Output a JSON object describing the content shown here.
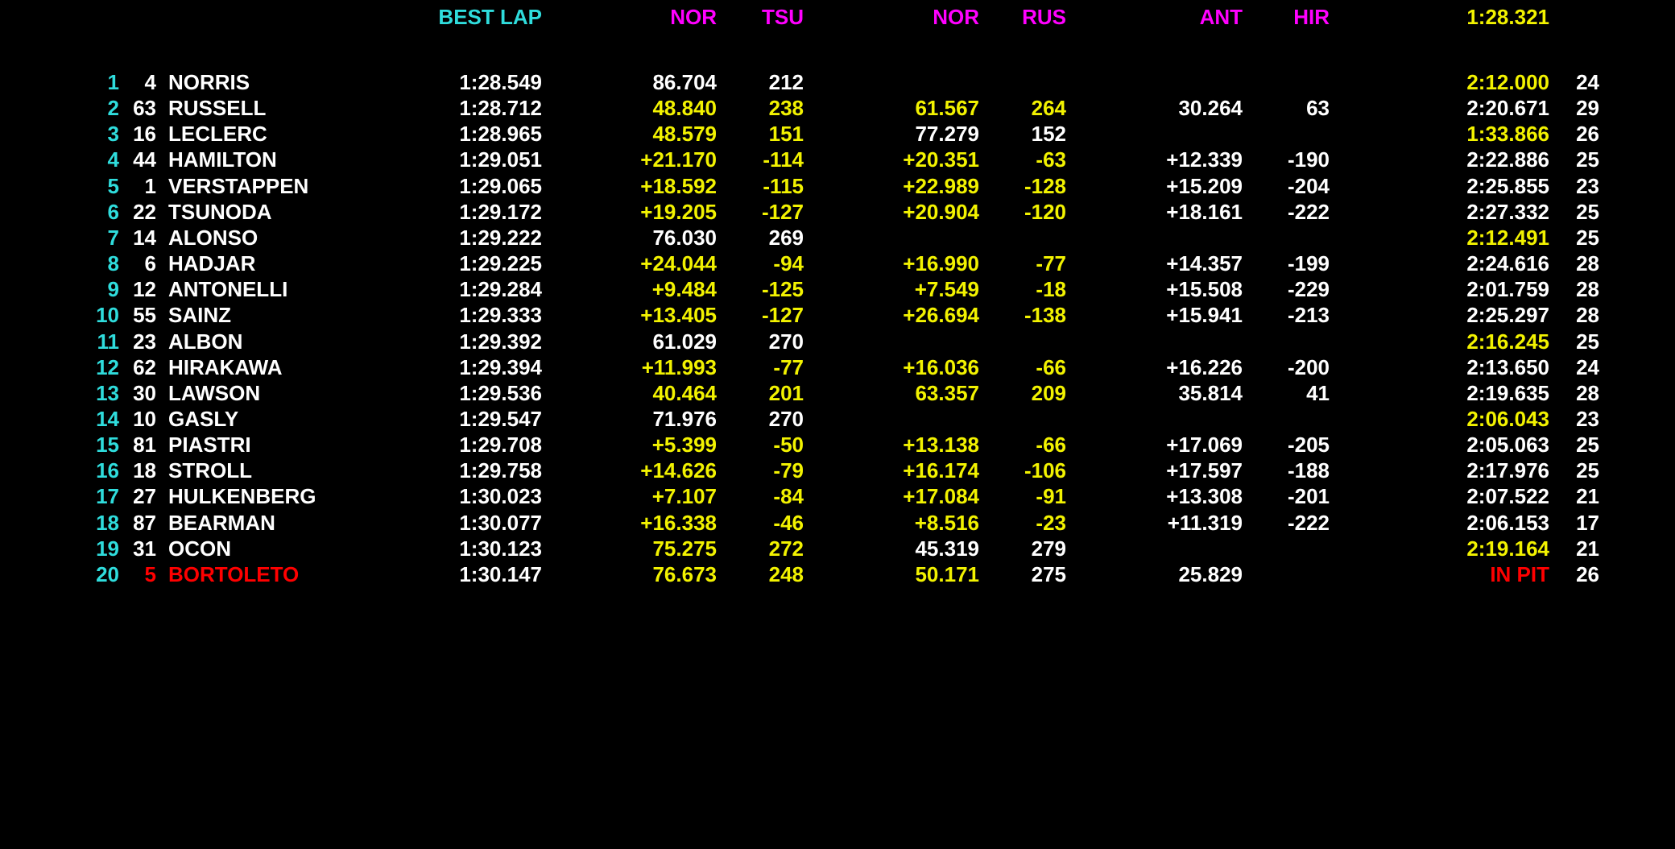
{
  "colors": {
    "background": "#000000",
    "white": "#ffffff",
    "yellow": "#f2f200",
    "cyan": "#2fdcdc",
    "magenta": "#ff00ff",
    "red": "#ff0000"
  },
  "header": {
    "best_lap": "BEST LAP",
    "g1": "NOR",
    "s1": "TSU",
    "g2": "NOR",
    "s2": "RUS",
    "g3": "ANT",
    "s3": "HIR",
    "last": "1:28.321"
  },
  "rows": [
    {
      "pos": "1",
      "num": "4",
      "name": "NORRIS",
      "best": "1:28.549",
      "g1": "86.704",
      "g1c": "white",
      "s1": "212",
      "s1c": "white",
      "g2": "",
      "g2c": "white",
      "s2": "",
      "s2c": "white",
      "g3": "",
      "s3": "",
      "last": "2:12.000",
      "lastc": "yellow",
      "laps": "24",
      "namec": "white"
    },
    {
      "pos": "2",
      "num": "63",
      "name": "RUSSELL",
      "best": "1:28.712",
      "g1": "48.840",
      "g1c": "yellow",
      "s1": "238",
      "s1c": "yellow",
      "g2": "61.567",
      "g2c": "yellow",
      "s2": "264",
      "s2c": "yellow",
      "g3": "30.264",
      "s3": "63",
      "last": "2:20.671",
      "lastc": "white",
      "laps": "29",
      "namec": "white"
    },
    {
      "pos": "3",
      "num": "16",
      "name": "LECLERC",
      "best": "1:28.965",
      "g1": "48.579",
      "g1c": "yellow",
      "s1": "151",
      "s1c": "yellow",
      "g2": "77.279",
      "g2c": "white",
      "s2": "152",
      "s2c": "white",
      "g3": "",
      "s3": "",
      "last": "1:33.866",
      "lastc": "yellow",
      "laps": "26",
      "namec": "white"
    },
    {
      "pos": "4",
      "num": "44",
      "name": "HAMILTON",
      "best": "1:29.051",
      "g1": "+21.170",
      "g1c": "yellow",
      "s1": "-114",
      "s1c": "yellow",
      "g2": "+20.351",
      "g2c": "yellow",
      "s2": "-63",
      "s2c": "yellow",
      "g3": "+12.339",
      "s3": "-190",
      "last": "2:22.886",
      "lastc": "white",
      "laps": "25",
      "namec": "white"
    },
    {
      "pos": "5",
      "num": "1",
      "name": "VERSTAPPEN",
      "best": "1:29.065",
      "g1": "+18.592",
      "g1c": "yellow",
      "s1": "-115",
      "s1c": "yellow",
      "g2": "+22.989",
      "g2c": "yellow",
      "s2": "-128",
      "s2c": "yellow",
      "g3": "+15.209",
      "s3": "-204",
      "last": "2:25.855",
      "lastc": "white",
      "laps": "23",
      "namec": "white"
    },
    {
      "pos": "6",
      "num": "22",
      "name": "TSUNODA",
      "best": "1:29.172",
      "g1": "+19.205",
      "g1c": "yellow",
      "s1": "-127",
      "s1c": "yellow",
      "g2": "+20.904",
      "g2c": "yellow",
      "s2": "-120",
      "s2c": "yellow",
      "g3": "+18.161",
      "s3": "-222",
      "last": "2:27.332",
      "lastc": "white",
      "laps": "25",
      "namec": "white"
    },
    {
      "pos": "7",
      "num": "14",
      "name": "ALONSO",
      "best": "1:29.222",
      "g1": "76.030",
      "g1c": "white",
      "s1": "269",
      "s1c": "white",
      "g2": "",
      "g2c": "white",
      "s2": "",
      "s2c": "white",
      "g3": "",
      "s3": "",
      "last": "2:12.491",
      "lastc": "yellow",
      "laps": "25",
      "namec": "white"
    },
    {
      "pos": "8",
      "num": "6",
      "name": "HADJAR",
      "best": "1:29.225",
      "g1": "+24.044",
      "g1c": "yellow",
      "s1": "-94",
      "s1c": "yellow",
      "g2": "+16.990",
      "g2c": "yellow",
      "s2": "-77",
      "s2c": "yellow",
      "g3": "+14.357",
      "s3": "-199",
      "last": "2:24.616",
      "lastc": "white",
      "laps": "28",
      "namec": "white"
    },
    {
      "pos": "9",
      "num": "12",
      "name": "ANTONELLI",
      "best": "1:29.284",
      "g1": "+9.484",
      "g1c": "yellow",
      "s1": "-125",
      "s1c": "yellow",
      "g2": "+7.549",
      "g2c": "yellow",
      "s2": "-18",
      "s2c": "yellow",
      "g3": "+15.508",
      "s3": "-229",
      "last": "2:01.759",
      "lastc": "white",
      "laps": "28",
      "namec": "white"
    },
    {
      "pos": "10",
      "num": "55",
      "name": "SAINZ",
      "best": "1:29.333",
      "g1": "+13.405",
      "g1c": "yellow",
      "s1": "-127",
      "s1c": "yellow",
      "g2": "+26.694",
      "g2c": "yellow",
      "s2": "-138",
      "s2c": "yellow",
      "g3": "+15.941",
      "s3": "-213",
      "last": "2:25.297",
      "lastc": "white",
      "laps": "28",
      "namec": "white"
    },
    {
      "pos": "11",
      "num": "23",
      "name": "ALBON",
      "best": "1:29.392",
      "g1": "61.029",
      "g1c": "white",
      "s1": "270",
      "s1c": "white",
      "g2": "",
      "g2c": "white",
      "s2": "",
      "s2c": "white",
      "g3": "",
      "s3": "",
      "last": "2:16.245",
      "lastc": "yellow",
      "laps": "25",
      "namec": "white"
    },
    {
      "pos": "12",
      "num": "62",
      "name": "HIRAKAWA",
      "best": "1:29.394",
      "g1": "+11.993",
      "g1c": "yellow",
      "s1": "-77",
      "s1c": "yellow",
      "g2": "+16.036",
      "g2c": "yellow",
      "s2": "-66",
      "s2c": "yellow",
      "g3": "+16.226",
      "s3": "-200",
      "last": "2:13.650",
      "lastc": "white",
      "laps": "24",
      "namec": "white"
    },
    {
      "pos": "13",
      "num": "30",
      "name": "LAWSON",
      "best": "1:29.536",
      "g1": "40.464",
      "g1c": "yellow",
      "s1": "201",
      "s1c": "yellow",
      "g2": "63.357",
      "g2c": "yellow",
      "s2": "209",
      "s2c": "yellow",
      "g3": "35.814",
      "s3": "41",
      "last": "2:19.635",
      "lastc": "white",
      "laps": "28",
      "namec": "white"
    },
    {
      "pos": "14",
      "num": "10",
      "name": "GASLY",
      "best": "1:29.547",
      "g1": "71.976",
      "g1c": "white",
      "s1": "270",
      "s1c": "white",
      "g2": "",
      "g2c": "white",
      "s2": "",
      "s2c": "white",
      "g3": "",
      "s3": "",
      "last": "2:06.043",
      "lastc": "yellow",
      "laps": "23",
      "namec": "white"
    },
    {
      "pos": "15",
      "num": "81",
      "name": "PIASTRI",
      "best": "1:29.708",
      "g1": "+5.399",
      "g1c": "yellow",
      "s1": "-50",
      "s1c": "yellow",
      "g2": "+13.138",
      "g2c": "yellow",
      "s2": "-66",
      "s2c": "yellow",
      "g3": "+17.069",
      "s3": "-205",
      "last": "2:05.063",
      "lastc": "white",
      "laps": "25",
      "namec": "white"
    },
    {
      "pos": "16",
      "num": "18",
      "name": "STROLL",
      "best": "1:29.758",
      "g1": "+14.626",
      "g1c": "yellow",
      "s1": "-79",
      "s1c": "yellow",
      "g2": "+16.174",
      "g2c": "yellow",
      "s2": "-106",
      "s2c": "yellow",
      "g3": "+17.597",
      "s3": "-188",
      "last": "2:17.976",
      "lastc": "white",
      "laps": "25",
      "namec": "white"
    },
    {
      "pos": "17",
      "num": "27",
      "name": "HULKENBERG",
      "best": "1:30.023",
      "g1": "+7.107",
      "g1c": "yellow",
      "s1": "-84",
      "s1c": "yellow",
      "g2": "+17.084",
      "g2c": "yellow",
      "s2": "-91",
      "s2c": "yellow",
      "g3": "+13.308",
      "s3": "-201",
      "last": "2:07.522",
      "lastc": "white",
      "laps": "21",
      "namec": "white"
    },
    {
      "pos": "18",
      "num": "87",
      "name": "BEARMAN",
      "best": "1:30.077",
      "g1": "+16.338",
      "g1c": "yellow",
      "s1": "-46",
      "s1c": "yellow",
      "g2": "+8.516",
      "g2c": "yellow",
      "s2": "-23",
      "s2c": "yellow",
      "g3": "+11.319",
      "s3": "-222",
      "last": "2:06.153",
      "lastc": "white",
      "laps": "17",
      "namec": "white"
    },
    {
      "pos": "19",
      "num": "31",
      "name": "OCON",
      "best": "1:30.123",
      "g1": "75.275",
      "g1c": "yellow",
      "s1": "272",
      "s1c": "yellow",
      "g2": "45.319",
      "g2c": "white",
      "s2": "279",
      "s2c": "white",
      "g3": "",
      "s3": "",
      "last": "2:19.164",
      "lastc": "yellow",
      "laps": "21",
      "namec": "white"
    },
    {
      "pos": "20",
      "num": "5",
      "name": "BORTOLETO",
      "best": "1:30.147",
      "g1": "76.673",
      "g1c": "yellow",
      "s1": "248",
      "s1c": "yellow",
      "g2": "50.171",
      "g2c": "yellow",
      "s2": "275",
      "s2c": "white",
      "g3": "25.829",
      "s3": "",
      "last": "IN PIT",
      "lastc": "red",
      "laps": "26",
      "namec": "red"
    }
  ]
}
